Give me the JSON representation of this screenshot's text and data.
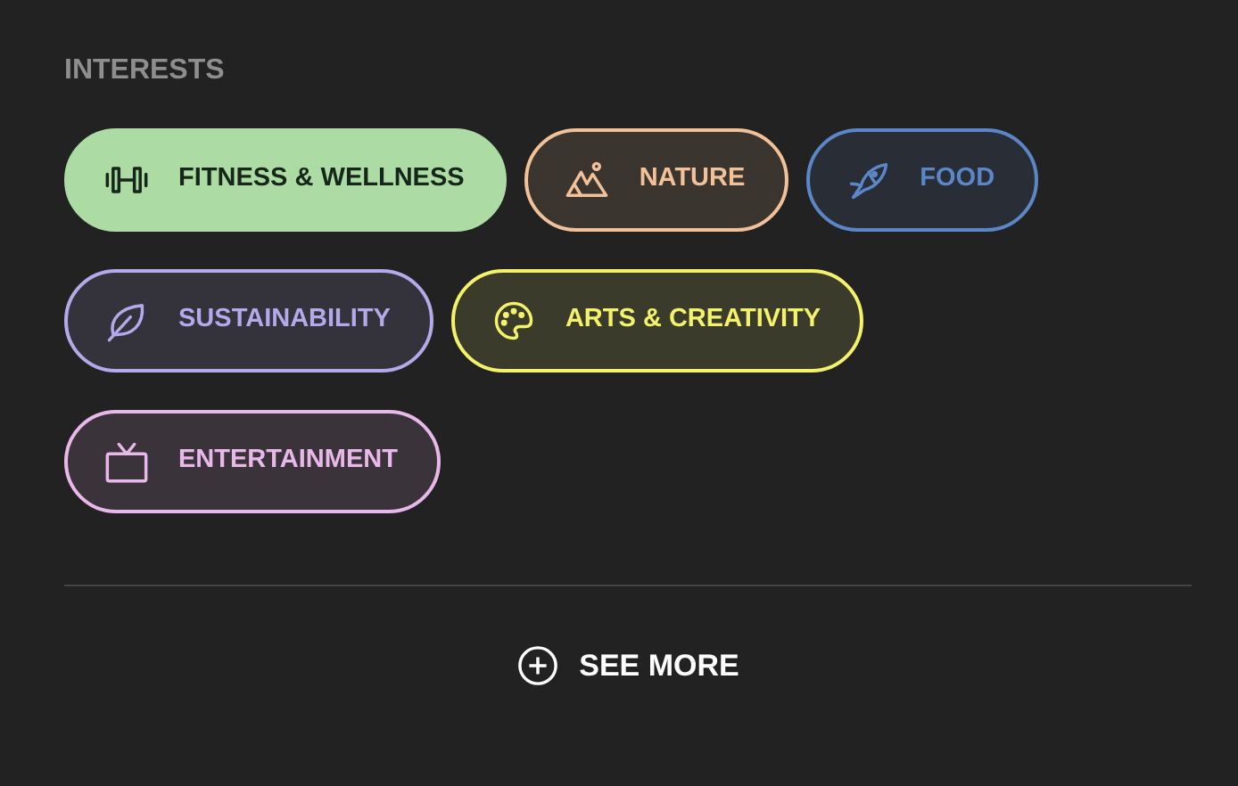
{
  "heading": "INTERESTS",
  "interests": [
    {
      "label": "FITNESS & WELLNESS",
      "selected": true,
      "color": "#acdca3"
    },
    {
      "label": "NATURE",
      "selected": false,
      "color": "#f2c197"
    },
    {
      "label": "FOOD",
      "selected": false,
      "color": "#5b86c8"
    },
    {
      "label": "SUSTAINABILITY",
      "selected": false,
      "color": "#b4a9ea"
    },
    {
      "label": "ARTS & CREATIVITY",
      "selected": false,
      "color": "#f3f26a"
    },
    {
      "label": "ENTERTAINMENT",
      "selected": false,
      "color": "#e9b8ea"
    }
  ],
  "see_more": "SEE MORE"
}
